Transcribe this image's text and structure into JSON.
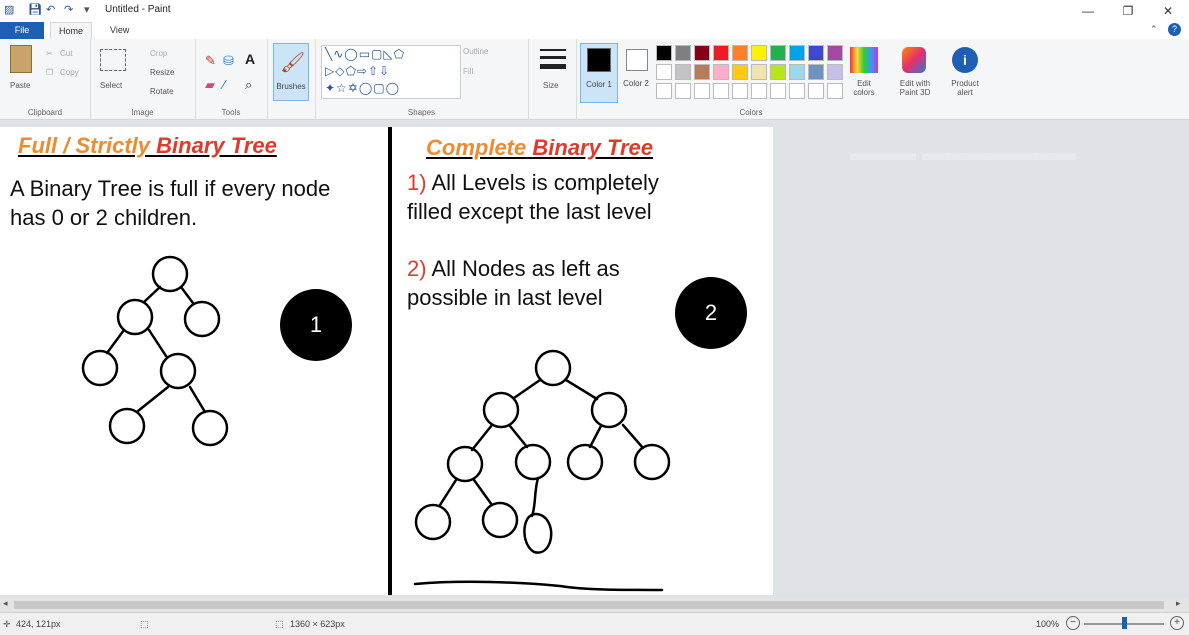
{
  "titlebar": {
    "title": "Untitled - Paint",
    "minimize": "—",
    "restore": "❐",
    "close": "✕"
  },
  "tabs": [
    "File",
    "Home",
    "View"
  ],
  "ribbon": {
    "clipboard": {
      "paste": "Paste",
      "cut": "Cut",
      "copy": "Copy",
      "label": "Clipboard"
    },
    "image": {
      "select": "Select",
      "crop": "Crop",
      "resize": "Resize",
      "rotate": "Rotate",
      "label": "Image"
    },
    "tools": {
      "label": "Tools"
    },
    "brushes": {
      "label": "Brushes"
    },
    "shapes": {
      "outline": "Outline",
      "fill": "Fill",
      "label": "Shapes"
    },
    "size": {
      "label": "Size"
    },
    "color1": {
      "label": "Color 1"
    },
    "color2": {
      "label": "Color 2"
    },
    "colors": {
      "label": "Colors",
      "edit": "Edit colors"
    },
    "paint3d": {
      "label": "Edit with Paint 3D"
    },
    "alert": {
      "label": "Product alert"
    }
  },
  "palette": [
    "#000000",
    "#7f7f7f",
    "#880015",
    "#ed1c24",
    "#ff7f27",
    "#fff200",
    "#22b14c",
    "#00a2e8",
    "#3f48cc",
    "#a349a4",
    "#ffffff",
    "#c3c3c3",
    "#b97a57",
    "#ffaec9",
    "#ffc90e",
    "#efe4b0",
    "#b5e61d",
    "#99d9ea",
    "#7092be",
    "#c8bfe7"
  ],
  "canvas": {
    "left": {
      "heading_part1": "Full / Strictly",
      "heading_part2": "Binary Tree",
      "line1": "A Binary Tree is full if every node",
      "line2": "has 0 or 2 children.",
      "badge": "1"
    },
    "right": {
      "heading_part1": "Complete",
      "heading_part2": "Binary Tree",
      "p1_num": "1)",
      "p1_line1": "All Levels is completely",
      "p1_line2": "filled except the last level",
      "p2_num": "2)",
      "p2_line1": "All Nodes as left as",
      "p2_line2": "possible in last level",
      "badge": "2"
    }
  },
  "status": {
    "position": "424, 121px",
    "size": "1360 × 623px",
    "zoom": "100%"
  },
  "colors": {
    "accent": "#1e5fb4"
  }
}
